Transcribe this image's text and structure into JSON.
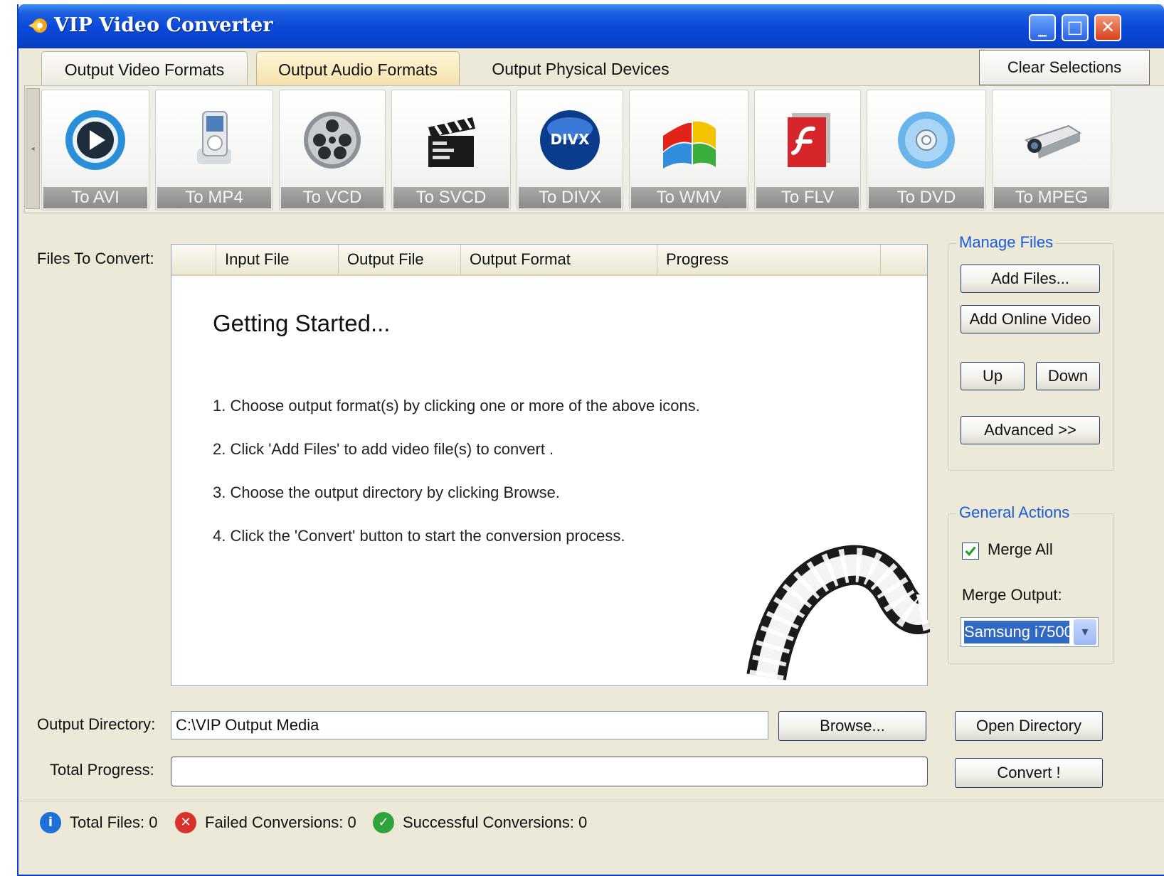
{
  "window": {
    "title": "VIP Video Converter"
  },
  "colors": {
    "titlebar": "#0a48d8",
    "accent": "#1a5cd6",
    "selection": "#316ac5",
    "tab_active": "#f3e0a8"
  },
  "tabs": [
    {
      "label": "Output Video Formats"
    },
    {
      "label": "Output Audio Formats"
    },
    {
      "label": "Output Physical Devices"
    }
  ],
  "clear_selections_label": "Clear Selections",
  "formats": [
    {
      "label": "To AVI",
      "icon": "play-circle-icon"
    },
    {
      "label": "To MP4",
      "icon": "ipod-icon"
    },
    {
      "label": "To VCD",
      "icon": "film-reel-icon"
    },
    {
      "label": "To SVCD",
      "icon": "clapperboard-icon"
    },
    {
      "label": "To DIVX",
      "icon": "divx-logo-icon"
    },
    {
      "label": "To WMV",
      "icon": "windows-media-icon"
    },
    {
      "label": "To FLV",
      "icon": "flash-icon"
    },
    {
      "label": "To DVD",
      "icon": "disc-icon"
    },
    {
      "label": "To MPEG",
      "icon": "projector-icon"
    }
  ],
  "files": {
    "label": "Files To Convert:",
    "columns": [
      "Input File",
      "Output File",
      "Output Format",
      "Progress"
    ],
    "getting_started": {
      "title": "Getting Started...",
      "steps": [
        "1. Choose output format(s) by clicking one or more of the above icons.",
        "2. Click 'Add Files' to add video file(s) to convert .",
        "3. Choose the output directory by clicking Browse.",
        "4. Click the 'Convert' button to start the conversion process."
      ]
    }
  },
  "manage_files": {
    "title": "Manage Files",
    "add_files": "Add Files...",
    "add_online": "Add Online Video",
    "up": "Up",
    "down": "Down",
    "advanced": "Advanced  >>"
  },
  "general_actions": {
    "title": "General Actions",
    "merge_all_label": "Merge All",
    "merge_all_checked": true,
    "merge_output_label": "Merge Output:",
    "merge_output_value": "Samsung i7500"
  },
  "output": {
    "dir_label": "Output Directory:",
    "dir_value": "C:\\VIP Output Media",
    "browse": "Browse...",
    "open_dir": "Open Directory",
    "progress_label": "Total Progress:",
    "progress_value": 0,
    "convert": "Convert !"
  },
  "status": {
    "total": "Total Files: 0",
    "failed": "Failed Conversions: 0",
    "success": "Successful Conversions: 0"
  }
}
